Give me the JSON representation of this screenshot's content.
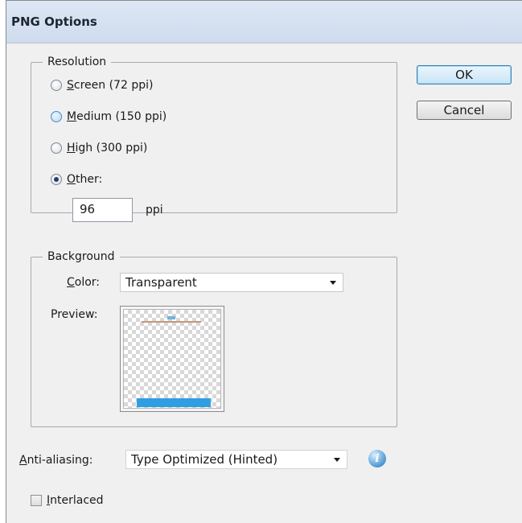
{
  "dialog": {
    "title": "PNG Options"
  },
  "buttons": {
    "ok": "OK",
    "cancel": "Cancel"
  },
  "resolution": {
    "legend": "Resolution",
    "options": [
      {
        "key": "S",
        "rest": "creen (72 ppi)",
        "selected": false
      },
      {
        "key": "M",
        "rest": "edium (150 ppi)",
        "selected": false
      },
      {
        "key": "H",
        "rest": "igh (300 ppi)",
        "selected": false
      },
      {
        "key": "O",
        "rest": "ther:",
        "selected": true
      }
    ],
    "other_value": "96",
    "unit": "ppi"
  },
  "background": {
    "legend": "Background",
    "color_label_key": "C",
    "color_label_rest": "olor:",
    "color_value": "Transparent",
    "preview_label": "Preview:"
  },
  "antialiasing": {
    "label_key": "A",
    "label_rest": "nti-aliasing:",
    "value": "Type Optimized (Hinted)",
    "info_icon": "info-icon"
  },
  "interlaced": {
    "label_key": "I",
    "label_rest": "nterlaced",
    "checked": false
  },
  "colors": {
    "title_bar": "#cfdcee",
    "dialog_bg": "#f0f0f0",
    "preview_blue": "#2f9ee2",
    "default_button_border": "#3c7fb1"
  }
}
